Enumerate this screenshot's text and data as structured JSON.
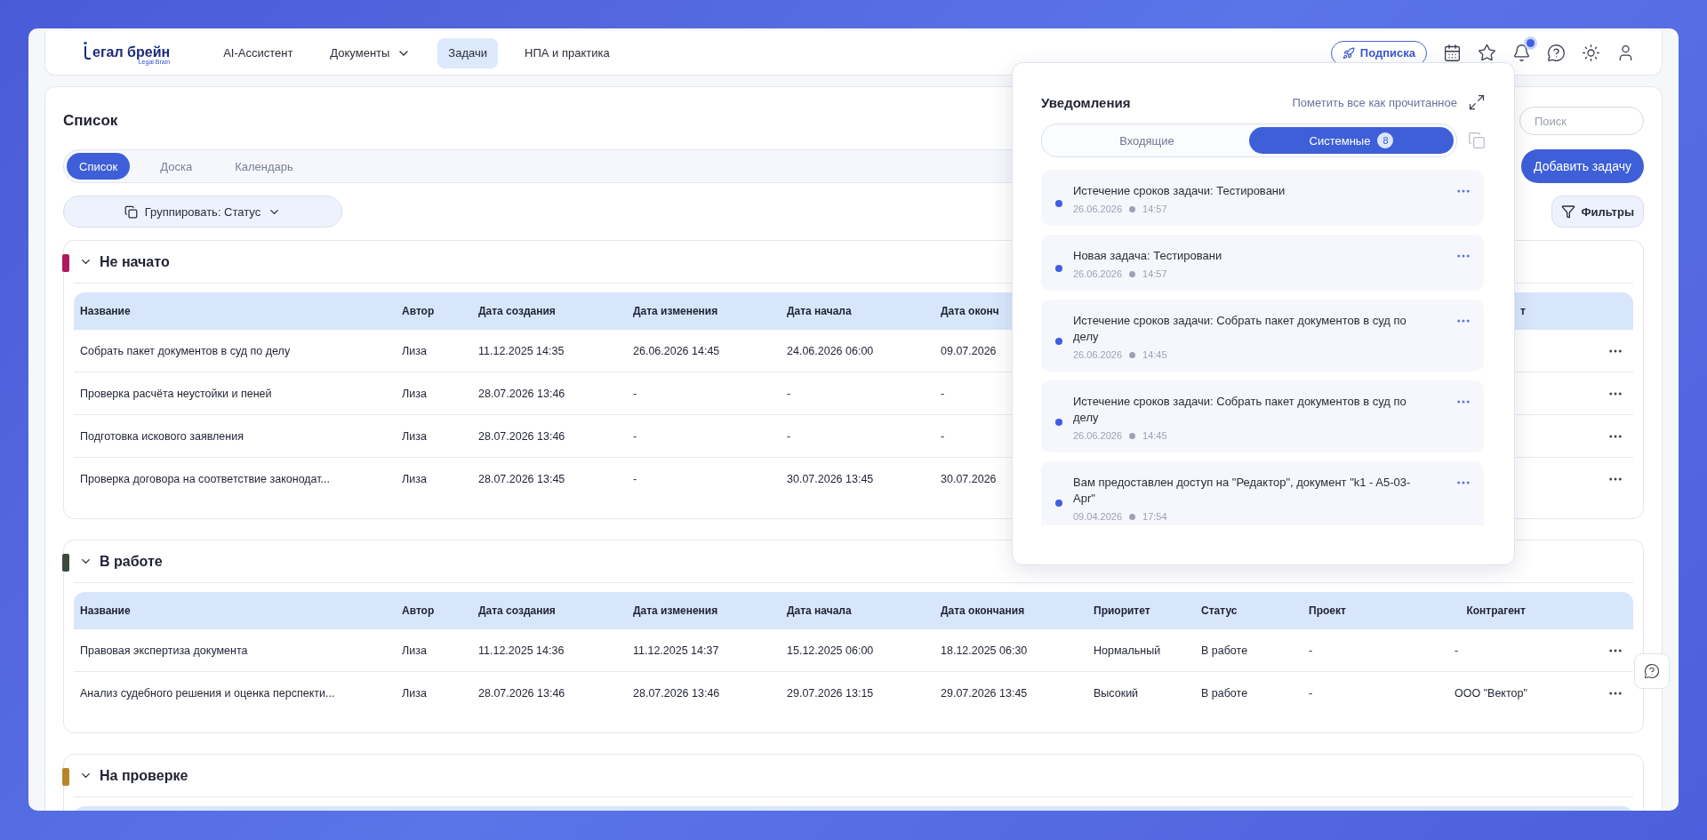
{
  "header": {
    "logo": {
      "wordmark": "егал брейн",
      "tagline": "Legal Brain"
    },
    "nav": [
      {
        "label": "AI-Ассистент",
        "kind": "link",
        "selected": false
      },
      {
        "label": "Документы",
        "kind": "dropdown",
        "selected": false
      },
      {
        "label": "Задачи",
        "kind": "link",
        "selected": true
      },
      {
        "label": "НПА и практика",
        "kind": "link",
        "selected": false
      }
    ],
    "subscribe_button": "Подписка",
    "notifications_unread": true
  },
  "page": {
    "title": "Список",
    "search": {
      "placeholder": "Поиск"
    },
    "view_tabs": [
      {
        "label": "Список",
        "selected": true
      },
      {
        "label": "Доска",
        "selected": false
      },
      {
        "label": "Календарь",
        "selected": false
      }
    ],
    "add_button": "Добавить задачу",
    "group_button": "Группировать: Статус",
    "filters_button": "Фильтры",
    "groups": [
      {
        "title": "Не начато",
        "color": "#b0195e",
        "columns": [
          "Название",
          "Автор",
          "Дата создания",
          "Дата изменения",
          "Дата начала",
          "Дата оконч",
          null,
          null,
          null,
          "т"
        ],
        "rows": [
          {
            "cells": [
              "Собрать пакет документов в суд по делу",
              "Лиза",
              "11.12.2025 14:35",
              "26.06.2026 14:45",
              "24.06.2026 06:00",
              "09.07.2026"
            ]
          },
          {
            "cells": [
              "Проверка расчёта неустойки и пеней",
              "Лиза",
              "28.07.2026 13:46",
              "-",
              "-",
              "-"
            ]
          },
          {
            "cells": [
              "Подготовка искового заявления",
              "Лиза",
              "28.07.2026 13:46",
              "-",
              "-",
              "-"
            ]
          },
          {
            "cells": [
              "Проверка договора на соответствие законодат...",
              "Лиза",
              "28.07.2026 13:45",
              "-",
              "30.07.2026 13:45",
              "30.07.2026"
            ]
          }
        ]
      },
      {
        "title": "В работе",
        "color": "#3d4a3f",
        "columns": [
          "Название",
          "Автор",
          "Дата создания",
          "Дата изменения",
          "Дата начала",
          "Дата окончания",
          "Приоритет",
          "Статус",
          "Проект",
          "Контрагент"
        ],
        "rows": [
          {
            "cells": [
              "Правовая экспертиза документа",
              "Лиза",
              "11.12.2025 14:36",
              "11.12.2025 14:37",
              "15.12.2025 06:00",
              "18.12.2025 06:30",
              "Нормальный",
              "В работе",
              "-",
              "-"
            ]
          },
          {
            "cells": [
              "Анализ судебного решения и оценка перспекти...",
              "Лиза",
              "28.07.2026 13:46",
              "28.07.2026 13:46",
              "29.07.2026 13:15",
              "29.07.2026 13:45",
              "Высокий",
              "В работе",
              "-",
              "ООО \"Вектор\""
            ]
          }
        ]
      },
      {
        "title": "На проверке",
        "color": "#b8862a"
      }
    ]
  },
  "notifications": {
    "title": "Уведомления",
    "mark_all": "Пометить все как прочитанное",
    "tabs": [
      {
        "label": "Входящие",
        "selected": false
      },
      {
        "label": "Системные",
        "selected": true,
        "count": "8"
      }
    ],
    "items": [
      {
        "title": "Истечение сроков задачи: Тестировани",
        "date": "26.06.2026",
        "time": "14:57",
        "unread": true
      },
      {
        "title": "Новая задача: Тестировани",
        "date": "26.06.2026",
        "time": "14:57",
        "unread": true
      },
      {
        "title": "Истечение сроков задачи: Собрать пакет документов в суд по делу",
        "date": "26.06.2026",
        "time": "14:45",
        "unread": true
      },
      {
        "title": "Истечение сроков задачи: Собрать пакет документов в суд по делу",
        "date": "26.06.2026",
        "time": "14:45",
        "unread": true
      },
      {
        "title": "Вам предоставлен доступ на \"Редактор\", документ \"k1 - A5-03-Apr\"",
        "date": "09.04.2026",
        "time": "17:54",
        "unread": true
      }
    ]
  }
}
